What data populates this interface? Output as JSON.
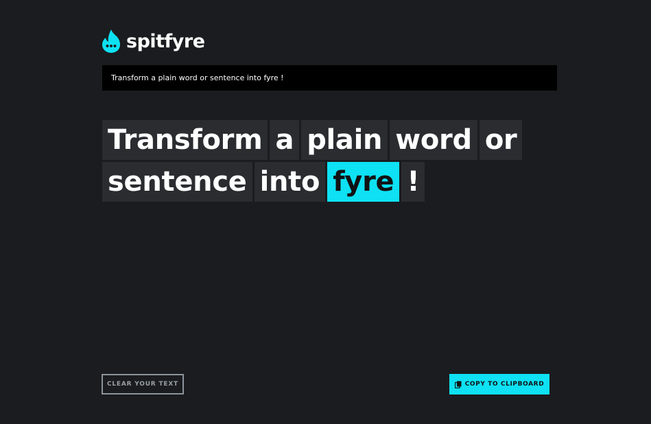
{
  "app": {
    "name": "spitfyre",
    "accent_color": "#0ee1f3",
    "logo_icon": "flame-chat-icon"
  },
  "input": {
    "value": "Transform a plain word or sentence into fyre !"
  },
  "words": [
    {
      "text": "Transform",
      "selected": false
    },
    {
      "text": "a",
      "selected": false
    },
    {
      "text": "plain",
      "selected": false
    },
    {
      "text": "word",
      "selected": false
    },
    {
      "text": "or",
      "selected": false
    },
    {
      "text": "sentence",
      "selected": false
    },
    {
      "text": "into",
      "selected": false
    },
    {
      "text": "fyre",
      "selected": true
    },
    {
      "text": "!",
      "selected": false
    }
  ],
  "buttons": {
    "clear_label": "CLEAR YOUR TEXT",
    "copy_label": "COPY TO CLIPBOARD",
    "copy_icon": "clipboard-icon"
  }
}
